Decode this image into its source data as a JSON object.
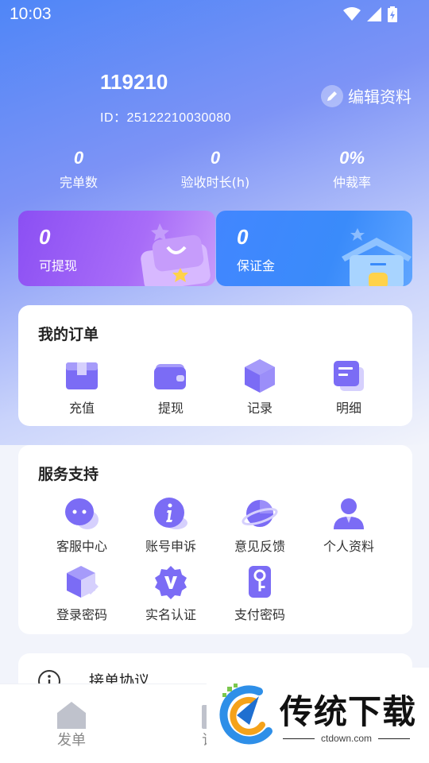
{
  "status_bar": {
    "time": "10:03"
  },
  "profile": {
    "name": "119210",
    "id_text": "ID：25122210030080",
    "edit_label": "编辑资料"
  },
  "stats": [
    {
      "value": "0",
      "label": "完单数"
    },
    {
      "value": "0",
      "label": "验收时长(h)"
    },
    {
      "value": "0%",
      "label": "仲裁率"
    }
  ],
  "wallet": {
    "withdrawable": {
      "value": "0",
      "label": "可提现"
    },
    "deposit": {
      "value": "0",
      "label": "保证金"
    }
  },
  "orders": {
    "title": "我的订单",
    "items": [
      {
        "label": "充值",
        "icon": "box-icon"
      },
      {
        "label": "提现",
        "icon": "wallet-icon"
      },
      {
        "label": "记录",
        "icon": "hexagon-icon"
      },
      {
        "label": "明细",
        "icon": "document-icon"
      }
    ]
  },
  "services": {
    "title": "服务支持",
    "items": [
      {
        "label": "客服中心",
        "icon": "chat-icon"
      },
      {
        "label": "账号申诉",
        "icon": "info-icon"
      },
      {
        "label": "意见反馈",
        "icon": "planet-icon"
      },
      {
        "label": "个人资料",
        "icon": "person-icon"
      },
      {
        "label": "登录密码",
        "icon": "cube-icon"
      },
      {
        "label": "实名认证",
        "icon": "badge-v-icon"
      },
      {
        "label": "支付密码",
        "icon": "key-icon"
      }
    ]
  },
  "list": {
    "agreement_label": "接单协议"
  },
  "bottom_nav": {
    "tab1": "发单",
    "tab2_partial": "订"
  },
  "watermark": {
    "title": "传统下载",
    "url": "ctdown.com"
  },
  "colors": {
    "accent_purple": "#8b4ff3",
    "accent_blue": "#4286ff",
    "icon_purple": "#7b6cf5"
  }
}
